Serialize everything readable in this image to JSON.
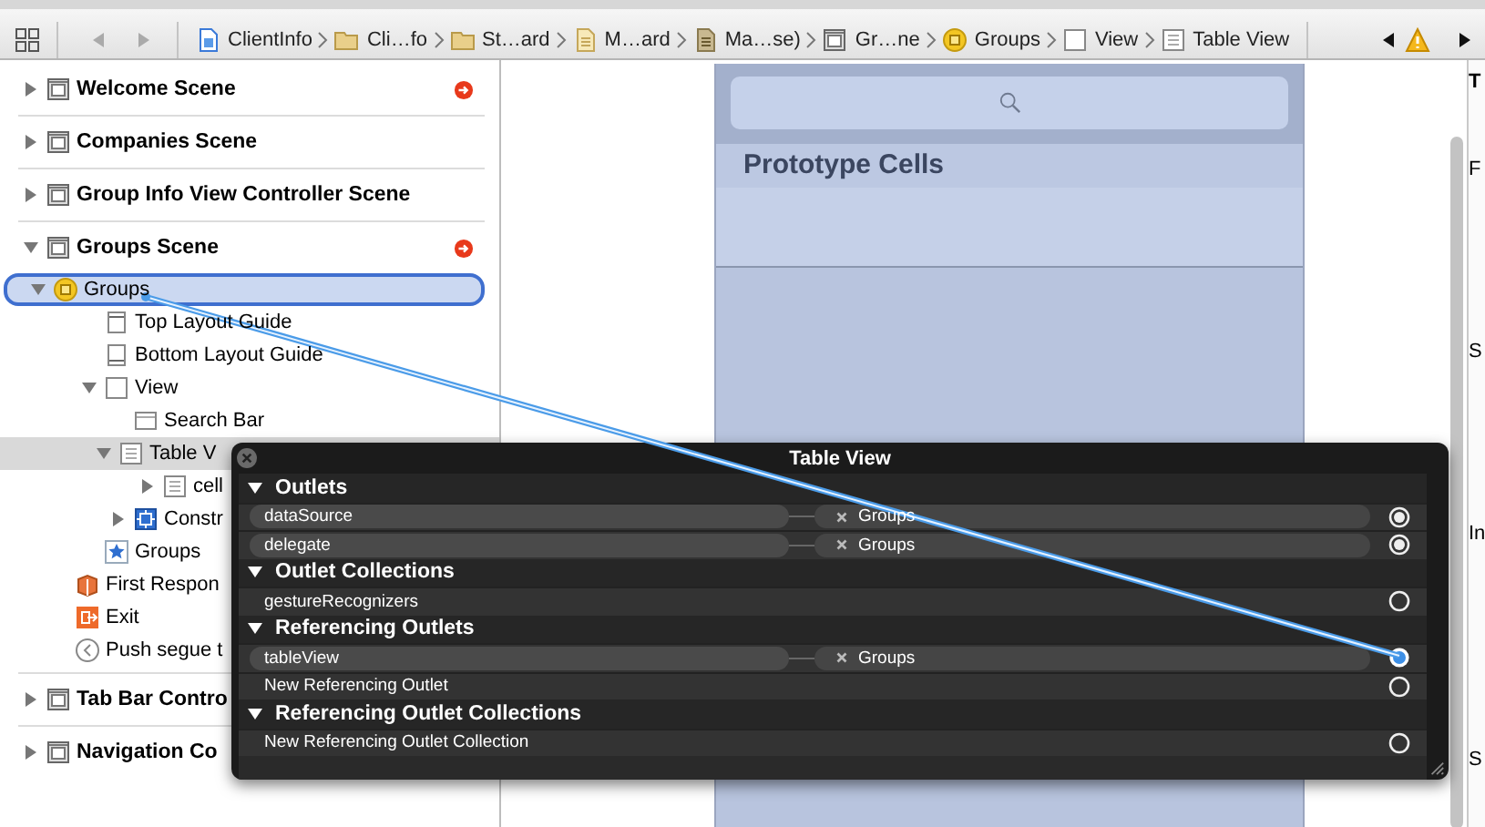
{
  "breadcrumb": {
    "items": [
      {
        "kind": "project",
        "label": "ClientInfo"
      },
      {
        "kind": "folder",
        "label": "Cli…fo"
      },
      {
        "kind": "folder",
        "label": "St…ard"
      },
      {
        "kind": "storyboard",
        "label": "M…ard"
      },
      {
        "kind": "storyboard-base",
        "label": "Ma…se)"
      },
      {
        "kind": "scene",
        "label": "Gr…ne"
      },
      {
        "kind": "controller",
        "label": "Groups"
      },
      {
        "kind": "view",
        "label": "View"
      },
      {
        "kind": "table",
        "label": "Table View"
      }
    ],
    "issue_warning": true
  },
  "outline": {
    "scenes": [
      {
        "label": "Welcome Scene",
        "kind": "scene",
        "expanded": false,
        "has_issue": true,
        "selected": false,
        "highlighted": false
      },
      {
        "label": "Companies Scene",
        "kind": "scene",
        "expanded": false,
        "has_issue": false,
        "selected": false,
        "highlighted": false
      },
      {
        "label": "Group Info View Controller Scene",
        "kind": "scene",
        "expanded": false,
        "has_issue": false,
        "selected": false,
        "highlighted": false
      },
      {
        "label": "Groups Scene",
        "kind": "scene",
        "expanded": true,
        "has_issue": true,
        "selected": false,
        "highlighted": false,
        "children": [
          {
            "label": "Groups",
            "kind": "controller",
            "expanded": true,
            "selected": true,
            "highlighted": false,
            "children": [
              {
                "label": "Top Layout Guide",
                "kind": "guide-top",
                "selected": false,
                "highlighted": false
              },
              {
                "label": "Bottom Layout Guide",
                "kind": "guide-bottom",
                "selected": false,
                "highlighted": false
              },
              {
                "label": "View",
                "kind": "view",
                "expanded": true,
                "selected": false,
                "highlighted": false,
                "children": [
                  {
                    "label": "Search Bar",
                    "kind": "searchbar",
                    "selected": false,
                    "highlighted": false
                  },
                  {
                    "label": "Table V",
                    "kind": "table",
                    "expanded": true,
                    "selected": false,
                    "highlighted": true,
                    "children": [
                      {
                        "label": "cell",
                        "kind": "table",
                        "expanded": false,
                        "selected": false,
                        "highlighted": false
                      }
                    ]
                  },
                  {
                    "label": "Constr",
                    "kind": "constraints",
                    "expanded": false,
                    "selected": false,
                    "highlighted": false
                  }
                ]
              },
              {
                "label": "Groups",
                "kind": "star",
                "selected": false,
                "highlighted": false
              }
            ]
          },
          {
            "label": "First Respon",
            "kind": "responder",
            "selected": false,
            "highlighted": false
          },
          {
            "label": "Exit",
            "kind": "exit",
            "selected": false,
            "highlighted": false
          },
          {
            "label": "Push segue t",
            "kind": "segue",
            "selected": false,
            "highlighted": false
          }
        ]
      },
      {
        "label": "Tab Bar Contro",
        "kind": "scene",
        "expanded": false,
        "has_issue": false,
        "selected": false,
        "highlighted": false
      },
      {
        "label": "Navigation Co",
        "kind": "scene",
        "expanded": false,
        "has_issue": false,
        "selected": false,
        "highlighted": false
      }
    ]
  },
  "canvas": {
    "section_header": "Prototype Cells"
  },
  "inspector": {
    "labels": [
      "T",
      "F",
      "S",
      "In",
      "S"
    ]
  },
  "popup": {
    "title": "Table View",
    "sections": [
      {
        "title": "Outlets",
        "expanded": true,
        "rows": [
          {
            "name": "dataSource",
            "target": "Groups",
            "connected": true,
            "dragging": false
          },
          {
            "name": "delegate",
            "target": "Groups",
            "connected": true,
            "dragging": false
          }
        ]
      },
      {
        "title": "Outlet Collections",
        "expanded": true,
        "rows": [
          {
            "name": "gestureRecognizers",
            "connected": false,
            "dragging": false
          }
        ]
      },
      {
        "title": "Referencing Outlets",
        "expanded": true,
        "rows": [
          {
            "name": "tableView",
            "target": "Groups",
            "connected": true,
            "dragging": true
          },
          {
            "name": "New Referencing Outlet",
            "connected": false,
            "dragging": false
          }
        ]
      },
      {
        "title": "Referencing Outlet Collections",
        "expanded": true,
        "rows": [
          {
            "name": "New Referencing Outlet Collection",
            "connected": false,
            "dragging": false
          }
        ]
      }
    ]
  }
}
